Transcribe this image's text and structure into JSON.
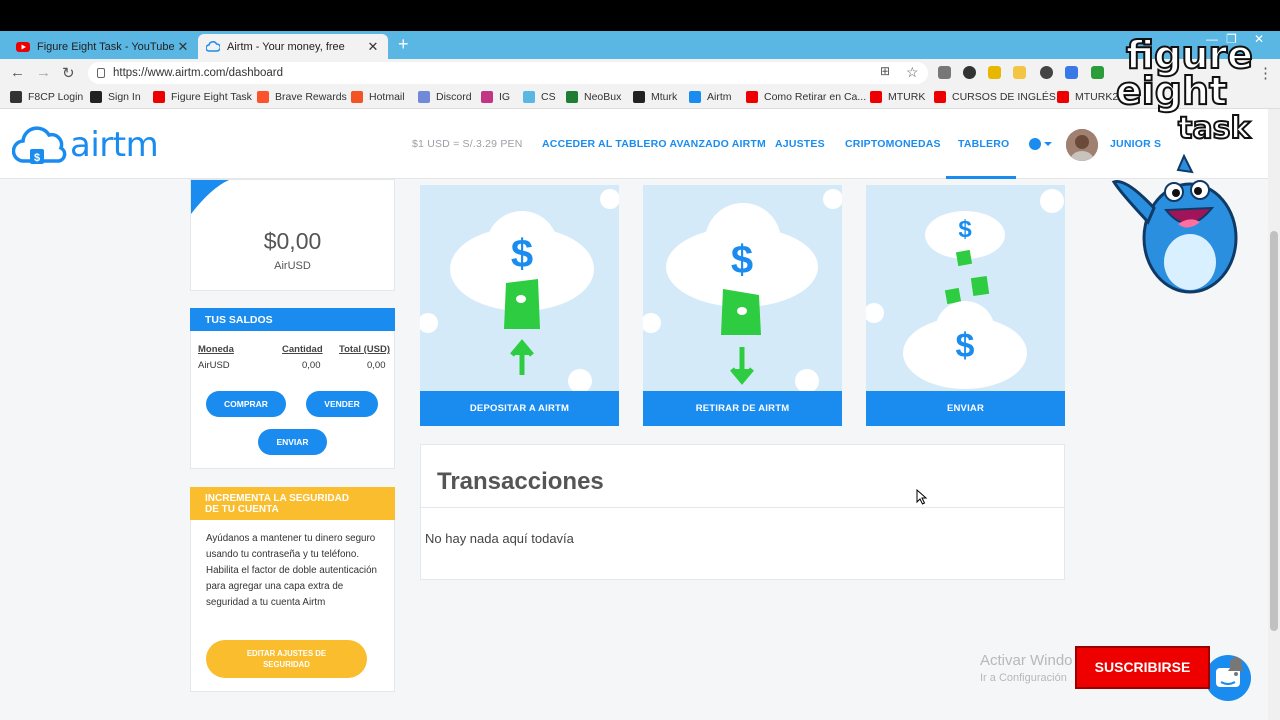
{
  "browser": {
    "tabs": [
      {
        "title": "Figure Eight Task - YouTube",
        "active": false
      },
      {
        "title": "Airtm - Your money, free",
        "active": true
      }
    ],
    "url": "https://www.airtm.com/dashboard",
    "bookmarks": [
      "F8CP Login",
      "Sign In",
      "Figure Eight Task",
      "Brave Rewards",
      "Hotmail",
      "Discord",
      "IG",
      "CS",
      "NeoBux",
      "Mturk",
      "Airtm",
      "Como Retirar en Ca...",
      "MTURK",
      "CURSOS DE INGLÉS...",
      "MTURK2"
    ]
  },
  "header": {
    "logo_text": "airtm",
    "rate": "$1 USD = S/.3.29 PEN",
    "nav": [
      "ACCEDER AL TABLERO AVANZADO AIRTM",
      "AJUSTES",
      "CRIPTOMONEDAS",
      "TABLERO"
    ],
    "active_nav": "TABLERO",
    "user": "JUNIOR S"
  },
  "balance": {
    "amount": "$0,00",
    "currency": "AirUSD"
  },
  "saldos": {
    "title": "TUS SALDOS",
    "columns": [
      "Moneda",
      "Cantidad",
      "Total (USD)"
    ],
    "rows": [
      [
        "AirUSD",
        "0,00",
        "0,00"
      ]
    ],
    "buttons": {
      "comprar": "COMPRAR",
      "vender": "VENDER",
      "enviar": "ENVIAR"
    }
  },
  "security": {
    "title_line1": "INCREMENTA LA SEGURIDAD",
    "title_line2": "DE TU CUENTA",
    "text": "Ayúdanos a mantener tu dinero seguro usando tu contraseña y tu teléfono. Habilita el factor de doble autenticación para agregar una capa extra de seguridad a tu cuenta Airtm",
    "button_line1": "EDITAR AJUSTES DE",
    "button_line2": "SEGURIDAD"
  },
  "actions": [
    {
      "label": "DEPOSITAR A AIRTM"
    },
    {
      "label": "RETIRAR DE AIRTM"
    },
    {
      "label": "ENVIAR"
    }
  ],
  "transactions": {
    "title": "Transacciones",
    "empty": "No hay nada aquí todavía"
  },
  "overlay": {
    "windows_line1": "Activar Windo",
    "windows_line2": "Ir a Configuración",
    "subscribe": "SUSCRIBIRSE",
    "brand_line1": "figure",
    "brand_line2": "eight",
    "brand_line3": "task"
  },
  "colors": {
    "accent": "#1a8cf0",
    "warning": "#f9bd2e",
    "green": "#2ecc40",
    "subscribe": "#ee0000"
  }
}
